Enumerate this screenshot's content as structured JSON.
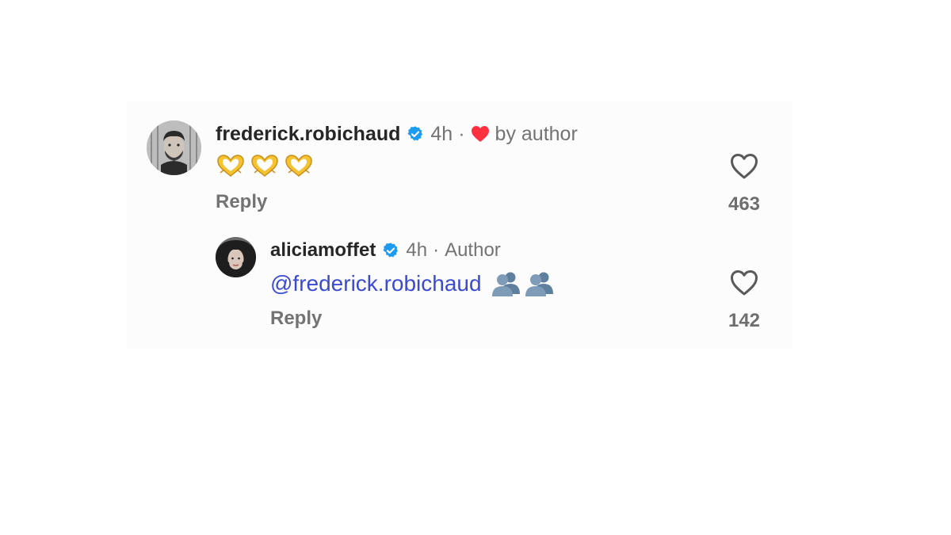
{
  "comments": [
    {
      "username": "frederick.robichaud",
      "verified": true,
      "time": "4h",
      "separator": "·",
      "meta_label": "by author",
      "liked_by_author_icon": "red-heart-icon",
      "text_emojis": [
        "heart-hands-emoji",
        "heart-hands-emoji",
        "heart-hands-emoji"
      ],
      "reply_label": "Reply",
      "like_icon": "heart-outline-icon",
      "like_count": "463"
    },
    {
      "username": "aliciamoffet",
      "verified": true,
      "time": "4h",
      "separator": "·",
      "meta_label": "Author",
      "mention": "@frederick.robichaud",
      "text_emojis": [
        "busts-in-silhouette-emoji",
        "busts-in-silhouette-emoji"
      ],
      "reply_label": "Reply",
      "like_icon": "heart-outline-icon",
      "like_count": "142"
    }
  ],
  "colors": {
    "verified_badge": "#1d9bf0",
    "liked_heart": "#ff3040",
    "mention": "#3b4bd0",
    "meta_text": "#737373"
  }
}
